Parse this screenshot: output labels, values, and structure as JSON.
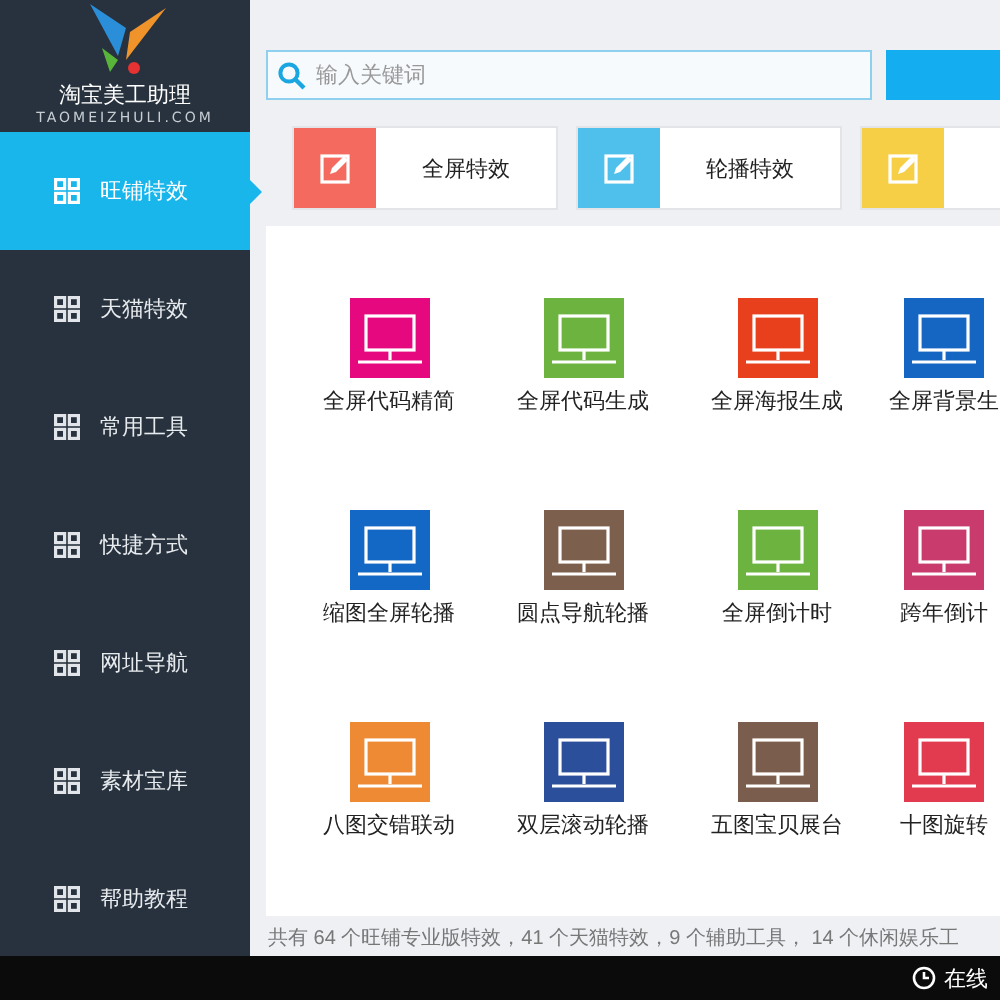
{
  "logo": {
    "title": "淘宝美工助理",
    "subtitle": "TAOMEIZHULI.COM"
  },
  "sidebar": {
    "items": [
      {
        "label": "旺铺特效",
        "selected": true
      },
      {
        "label": "天猫特效",
        "selected": false
      },
      {
        "label": "常用工具",
        "selected": false
      },
      {
        "label": "快捷方式",
        "selected": false
      },
      {
        "label": "网址导航",
        "selected": false
      },
      {
        "label": "素材宝库",
        "selected": false
      },
      {
        "label": "帮助教程",
        "selected": false
      }
    ]
  },
  "search": {
    "placeholder": "输入关键词"
  },
  "tabs": [
    {
      "label": "全屏特效",
      "color": "#f46a5e"
    },
    {
      "label": "轮播特效",
      "color": "#4fc0ec"
    },
    {
      "color": "#f7cf47"
    }
  ],
  "tools": [
    {
      "label": "全屏代码精简",
      "color": "#e5087f"
    },
    {
      "label": "全屏代码生成",
      "color": "#6cb33f"
    },
    {
      "label": "全屏海报生成",
      "color": "#e8401c"
    },
    {
      "label": "全屏背景生",
      "color": "#1565c2"
    },
    {
      "label": "缩图全屏轮播",
      "color": "#1268c4"
    },
    {
      "label": "圆点导航轮播",
      "color": "#7d5f4e"
    },
    {
      "label": "全屏倒计时",
      "color": "#6cb33f"
    },
    {
      "label": "跨年倒计",
      "color": "#c83b6c"
    },
    {
      "label": "八图交错联动",
      "color": "#ef8a34"
    },
    {
      "label": "双层滚动轮播",
      "color": "#2b4f9a"
    },
    {
      "label": "五图宝贝展台",
      "color": "#7a5d4c"
    },
    {
      "label": "十图旋转",
      "color": "#e23a4e"
    }
  ],
  "summary": "共有 64 个旺铺专业版特效，41 个天猫特效，9 个辅助工具， 14 个休闲娱乐工",
  "status_bar": {
    "label": "在线"
  }
}
